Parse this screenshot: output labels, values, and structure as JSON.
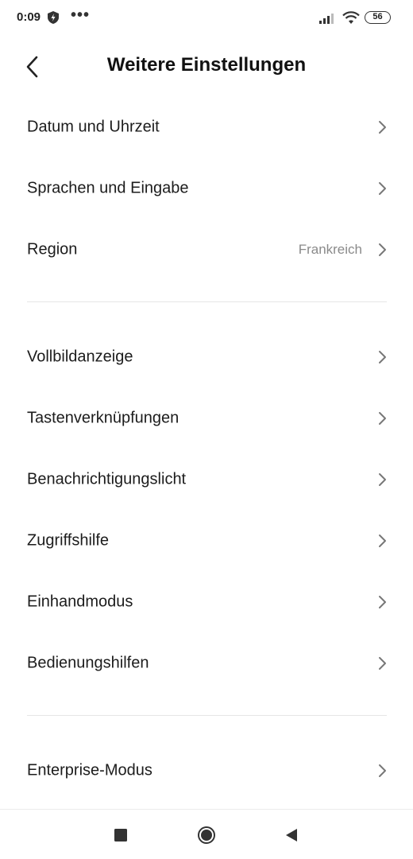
{
  "status_bar": {
    "time": "0:09",
    "more": "•••",
    "battery": "56"
  },
  "header": {
    "title": "Weitere Einstellungen"
  },
  "section1": [
    {
      "label": "Datum und Uhrzeit",
      "value": ""
    },
    {
      "label": "Sprachen und Eingabe",
      "value": ""
    },
    {
      "label": "Region",
      "value": "Frankreich"
    }
  ],
  "section2": [
    {
      "label": "Vollbildanzeige"
    },
    {
      "label": "Tastenverknüpfungen"
    },
    {
      "label": "Benachrichtigungslicht"
    },
    {
      "label": "Zugriffshilfe"
    },
    {
      "label": "Einhandmodus"
    },
    {
      "label": "Bedienungshilfen"
    }
  ],
  "section3": [
    {
      "label": "Enterprise-Modus"
    }
  ]
}
